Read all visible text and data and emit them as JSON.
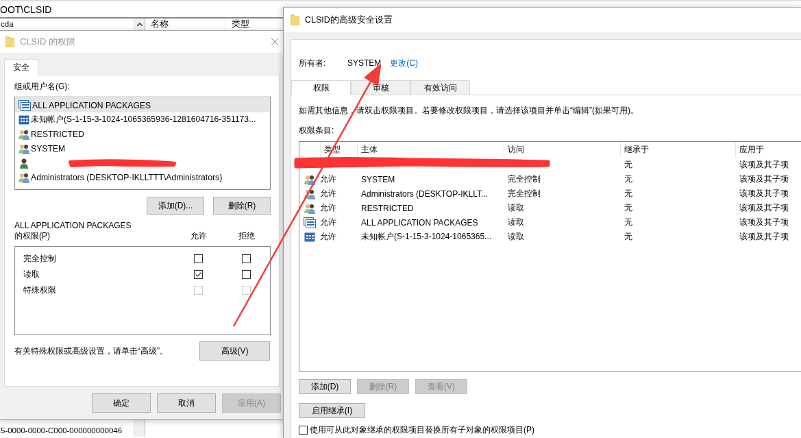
{
  "background_window": {
    "address": "OOT\\CLSID",
    "tree_items": [
      "cda",
      "5-0000-0000-C000-000000000046"
    ],
    "columns": [
      "名称",
      "类型"
    ]
  },
  "permissions_dialog": {
    "title": "CLSID 的权限",
    "tabs": [
      {
        "label": "安全",
        "selected": true
      }
    ],
    "group_label": "组或用户名(G):",
    "principals": [
      {
        "kind": "package",
        "name": "ALL APPLICATION PACKAGES",
        "selected": true
      },
      {
        "kind": "unknown",
        "name": "未知帐户(S-1-15-3-1024-1065365936-1281604716-351173...",
        "selected": false
      },
      {
        "kind": "group",
        "name": "RESTRICTED",
        "selected": false
      },
      {
        "kind": "group",
        "name": "SYSTEM",
        "selected": false
      },
      {
        "kind": "user",
        "selected": false
      },
      {
        "kind": "group",
        "name": "Administrators (DESKTOP-IKLLTTT\\Administrators)",
        "selected": false
      }
    ],
    "list_buttons": [
      {
        "label": "添加(D)...",
        "disabled": false
      },
      {
        "label": "删除(R)",
        "disabled": false
      }
    ],
    "permissions_for": "ALL APPLICATION PACKAGES",
    "permissions_label": "的权限(P)",
    "columns": [
      "允许",
      "拒绝"
    ],
    "permissions": [
      {
        "name": "完全控制",
        "allow": false,
        "deny": false,
        "disabled": false
      },
      {
        "name": "读取",
        "allow": true,
        "deny": false,
        "disabled": false
      },
      {
        "name": "特殊权限",
        "allow": false,
        "deny": false,
        "disabled": true
      }
    ],
    "hint": "有关特殊权限或高级设置，请单击“高级”。",
    "advanced_button": "高级(V)",
    "buttons": [
      {
        "label": "确定",
        "disabled": false
      },
      {
        "label": "取消",
        "disabled": false
      },
      {
        "label": "应用(A)",
        "disabled": true
      }
    ]
  },
  "advanced_dialog": {
    "title": "CLSID的高级安全设置",
    "owner_label": "所有者:",
    "owner": "SYSTEM",
    "change_link": "更改(C)",
    "tabs": [
      {
        "label": "权限",
        "selected": true
      },
      {
        "label": "审核",
        "selected": false
      },
      {
        "label": "有效访问",
        "selected": false
      }
    ],
    "info": "如需其他信息，请双击权限项目。若要修改权限项目，请选择该项目并单击“编辑”(如果可用)。",
    "entries_label": "权限条目:",
    "table": {
      "columns": [
        "类型",
        "主体",
        "访问",
        "继承于",
        "应用于"
      ],
      "rows": [
        {
          "inherited_from": "无",
          "applies_to": "该项及其子项"
        },
        {
          "kind": "group",
          "type": "允许",
          "principal": "SYSTEM",
          "access": "完全控制",
          "inherited_from": "无",
          "applies_to": "该项及其子项"
        },
        {
          "kind": "group",
          "type": "允许",
          "principal": "Administrators (DESKTOP-IKLLT...",
          "access": "完全控制",
          "inherited_from": "无",
          "applies_to": "该项及其子项"
        },
        {
          "kind": "group",
          "type": "允许",
          "principal": "RESTRICTED",
          "access": "读取",
          "inherited_from": "无",
          "applies_to": "该项及其子项"
        },
        {
          "kind": "package",
          "type": "允许",
          "principal": "ALL APPLICATION PACKAGES",
          "access": "读取",
          "inherited_from": "无",
          "applies_to": "该项及其子项"
        },
        {
          "kind": "unknown",
          "type": "允许",
          "principal": "未知帐户(S-1-15-3-1024-1065365...",
          "access": "读取",
          "inherited_from": "无",
          "applies_to": "该项及其子项"
        }
      ]
    },
    "buttons": [
      {
        "label": "添加(D)",
        "disabled": false
      },
      {
        "label": "删除(R)",
        "disabled": true
      },
      {
        "label": "查看(V)",
        "disabled": true
      }
    ],
    "inheritance_button": "启用继承(I)",
    "replace_option": {
      "label": "使用可从此对象继承的权限项目替换所有子对象的权限项目(P)",
      "checked": false
    }
  }
}
